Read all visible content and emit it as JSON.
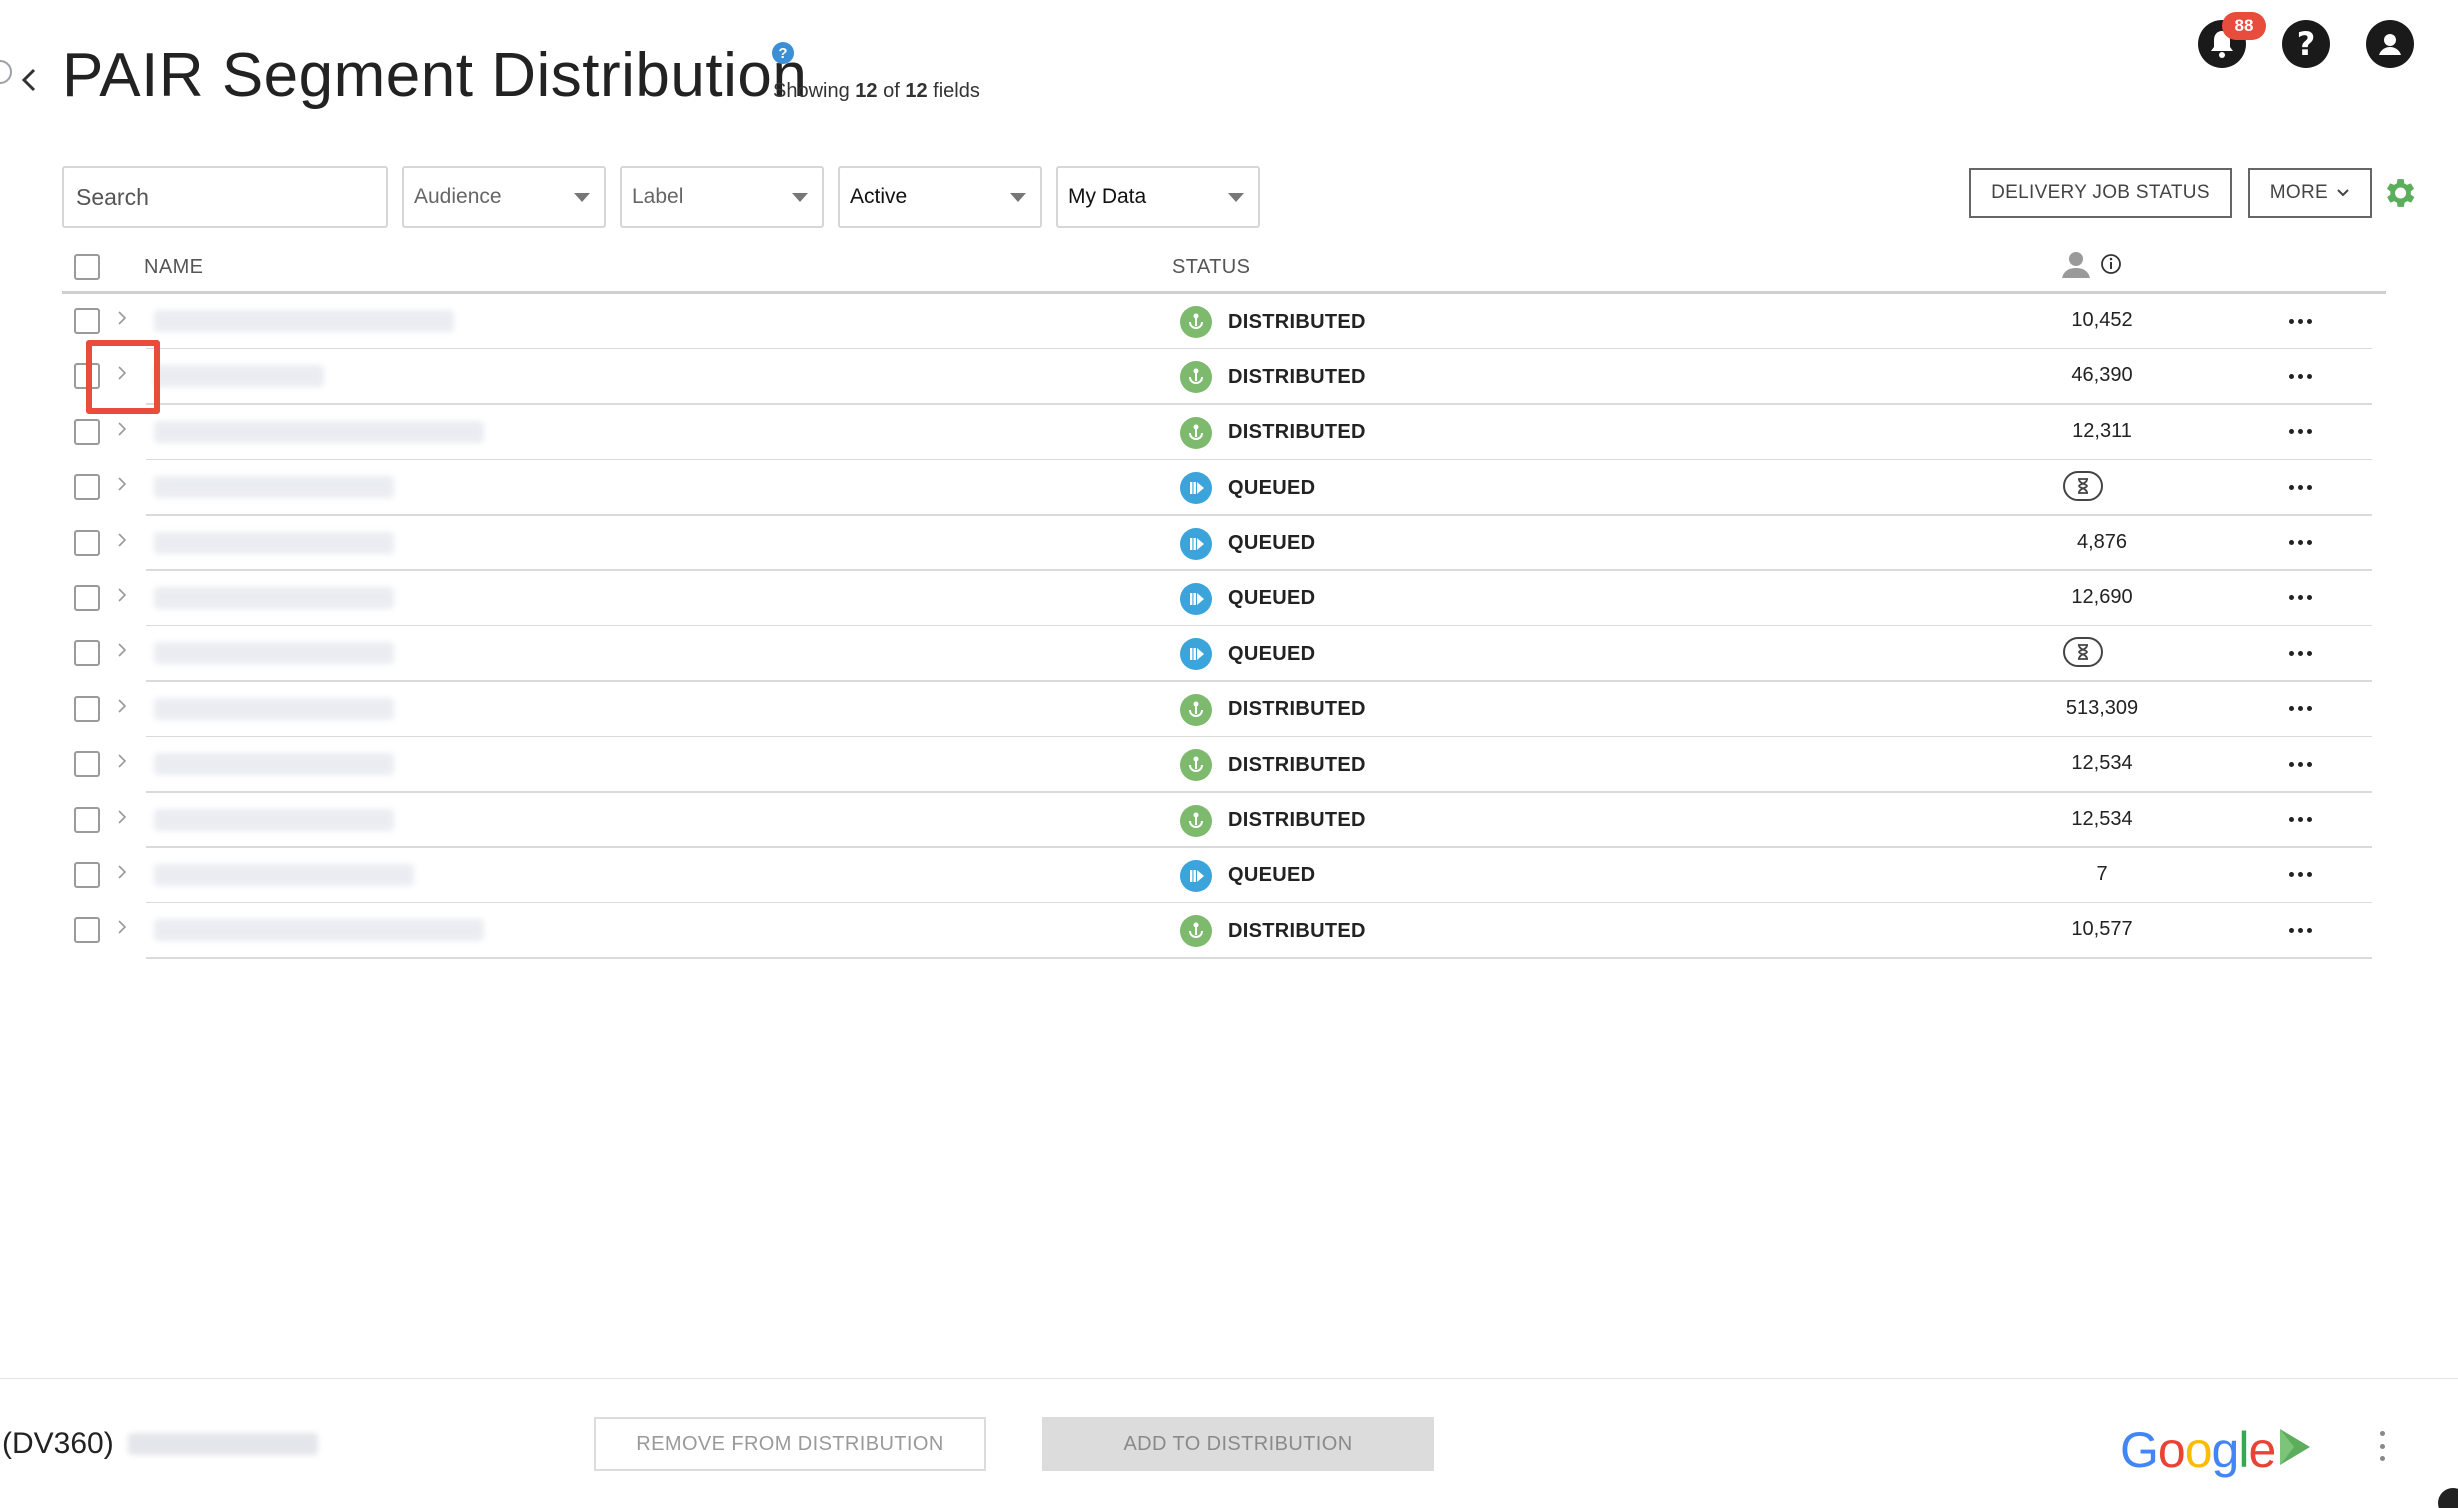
{
  "header": {
    "title": "PAIR Segment Distribution",
    "help_glyph": "?",
    "showing_prefix": "Showing",
    "showing_count": "12",
    "showing_of": "of",
    "showing_total": "12",
    "showing_suffix": "fields",
    "notification_count": "88",
    "help_icon_glyph": "?"
  },
  "filters": {
    "search_placeholder": "Search",
    "audience": "Audience",
    "label": "Label",
    "active": "Active",
    "my_data": "My Data"
  },
  "actions": {
    "delivery_job_status": "DELIVERY JOB STATUS",
    "more": "MORE"
  },
  "table": {
    "columns": {
      "name": "NAME",
      "status": "STATUS"
    },
    "rows": [
      {
        "status": "DISTRIBUTED",
        "status_kind": "distributed",
        "count": "10,452"
      },
      {
        "status": "DISTRIBUTED",
        "status_kind": "distributed",
        "count": "46,390"
      },
      {
        "status": "DISTRIBUTED",
        "status_kind": "distributed",
        "count": "12,311"
      },
      {
        "status": "QUEUED",
        "status_kind": "queued",
        "count": "",
        "pending": true
      },
      {
        "status": "QUEUED",
        "status_kind": "queued",
        "count": "4,876"
      },
      {
        "status": "QUEUED",
        "status_kind": "queued",
        "count": "12,690"
      },
      {
        "status": "QUEUED",
        "status_kind": "queued",
        "count": "",
        "pending": true
      },
      {
        "status": "DISTRIBUTED",
        "status_kind": "distributed",
        "count": "513,309"
      },
      {
        "status": "DISTRIBUTED",
        "status_kind": "distributed",
        "count": "12,534"
      },
      {
        "status": "DISTRIBUTED",
        "status_kind": "distributed",
        "count": "12,534"
      },
      {
        "status": "QUEUED",
        "status_kind": "queued",
        "count": "7"
      },
      {
        "status": "DISTRIBUTED",
        "status_kind": "distributed",
        "count": "10,577"
      }
    ]
  },
  "footer": {
    "platform": "(DV360)",
    "remove_button": "REMOVE FROM DISTRIBUTION",
    "add_button": "ADD TO DISTRIBUTION",
    "google_letters": [
      "G",
      "o",
      "o",
      "g",
      "l",
      "e"
    ]
  },
  "colors": {
    "distributed": "#7dba6e",
    "queued": "#3aa4db",
    "highlight": "#e74c3c",
    "badge": "#e74c3c",
    "gear": "#5cae5c",
    "google": [
      "#4285F4",
      "#EA4335",
      "#FBBC05",
      "#4285F4",
      "#34A853",
      "#EA4335"
    ]
  }
}
